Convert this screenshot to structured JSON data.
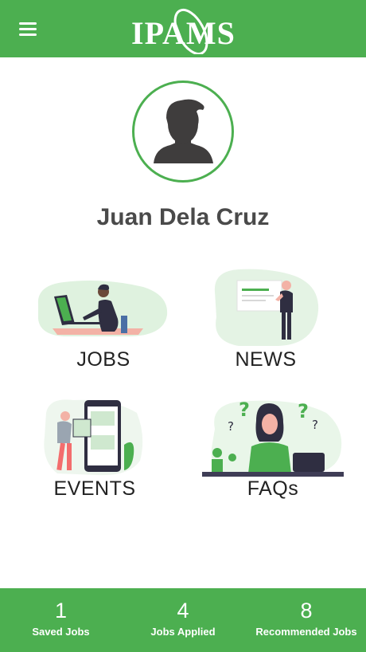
{
  "header": {
    "logo_text": "IPAMS",
    "menu_icon": "hamburger-menu-icon"
  },
  "profile": {
    "name": "Juan Dela Cruz",
    "avatar_icon": "user-silhouette-icon"
  },
  "tiles": [
    {
      "label": "JOBS",
      "icon": "person-at-laptop-illustration"
    },
    {
      "label": "NEWS",
      "icon": "person-with-board-illustration"
    },
    {
      "label": "EVENTS",
      "icon": "person-with-phone-photos-illustration"
    },
    {
      "label": "FAQs",
      "icon": "woman-thinking-questions-illustration"
    }
  ],
  "stats": [
    {
      "value": "1",
      "label": "Saved Jobs"
    },
    {
      "value": "4",
      "label": "Jobs Applied"
    },
    {
      "value": "8",
      "label": "Recommended Jobs"
    }
  ],
  "colors": {
    "primary": "#4caf50",
    "text": "#4a4a4a",
    "illustration_dark": "#2f2e41"
  }
}
